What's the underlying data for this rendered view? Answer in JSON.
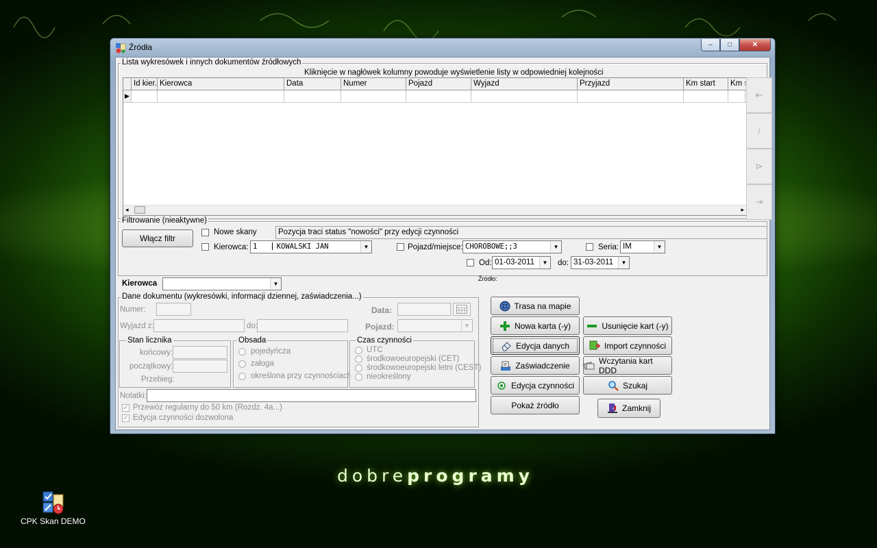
{
  "desktop": {
    "brand_light": "dobre",
    "brand_bold": "programy",
    "icon_label": "CPK Skan DEMO"
  },
  "window": {
    "title": "Źródła",
    "controls": {
      "minimize": "–",
      "maximize": "□",
      "close": "✕"
    }
  },
  "list": {
    "group_label": "Lista wykresówek i innych dokumentów źródłowych",
    "hint": "Kliknięcie w nagłówek kolumny powoduje wyświetlenie listy w odpowiedniej kolejności",
    "columns": [
      "Id kier.",
      "Kierowca",
      "Data",
      "Numer",
      "Pojazd",
      "Wyjazd",
      "Przyjazd",
      "Km start",
      "Km s"
    ],
    "row_indicator": "▶",
    "nav": [
      "⇤",
      "/",
      "⊳",
      "⇥"
    ]
  },
  "filter": {
    "group_label": "Filtrowanie (nieaktywne)",
    "enable_button": "Włącz filtr",
    "new_scans_label": "Nowe skany",
    "new_scans_hint": "Pozycja traci status \"nowości\" przy edycji czynności",
    "driver_label": "Kierowca:",
    "driver_id": "1",
    "driver_name": "KOWALSKI JAN",
    "vehicle_label": "Pojazd/miejsce:",
    "vehicle_value": "CHOROBOWE;;3",
    "series_label": "Seria:",
    "series_value": "IM",
    "from_label": "Od:",
    "from_value": "01-03-2011",
    "to_label": "do:",
    "to_value": "31-03-2011",
    "source_label": "Źródło:"
  },
  "driver_select": {
    "label": "Kierowca",
    "value": ""
  },
  "document": {
    "group_label": "Dane dokumentu (wykresówki, informacji dziennej, zaświadczenia...)",
    "number_label": "Numer:",
    "date_label": "Data:",
    "departure_label": "Wyjazd z:",
    "to_label": "do:",
    "vehicle_label": "Pojazd:",
    "counter": {
      "label": "Stan licznika",
      "end": "końcowy:",
      "start": "początkowy:",
      "mileage": "Przebieg:"
    },
    "crew": {
      "label": "Obsada",
      "options": [
        "pojedyńcza",
        "załoga",
        "określona przy czynnościach"
      ]
    },
    "time": {
      "label": "Czas czynności",
      "options": [
        "UTC",
        "środkowoeuropejski (CET)",
        "środkowoeuropejski letni (CEST)",
        "nieokreślony"
      ]
    },
    "notes_label": "Notatki:",
    "check1": "Przewóz regularny do 50 km (Rozdz. 4a...)",
    "check2": "Edycja czynności dozwolona"
  },
  "actions": {
    "route_map": "Trasa na mapie",
    "new_card": "Nowa karta (-y)",
    "remove_card": "Usunięcie kart (-y)",
    "edit_data": "Edycja danych",
    "import_activities": "Import czynności",
    "certificate": "Zaświadczenie",
    "load_ddd": "Wczytania kart DDD",
    "edit_activities": "Edycja czynności",
    "search": "Szukaj",
    "show_source": "Pokaż źródło",
    "close": "Zamknij"
  }
}
